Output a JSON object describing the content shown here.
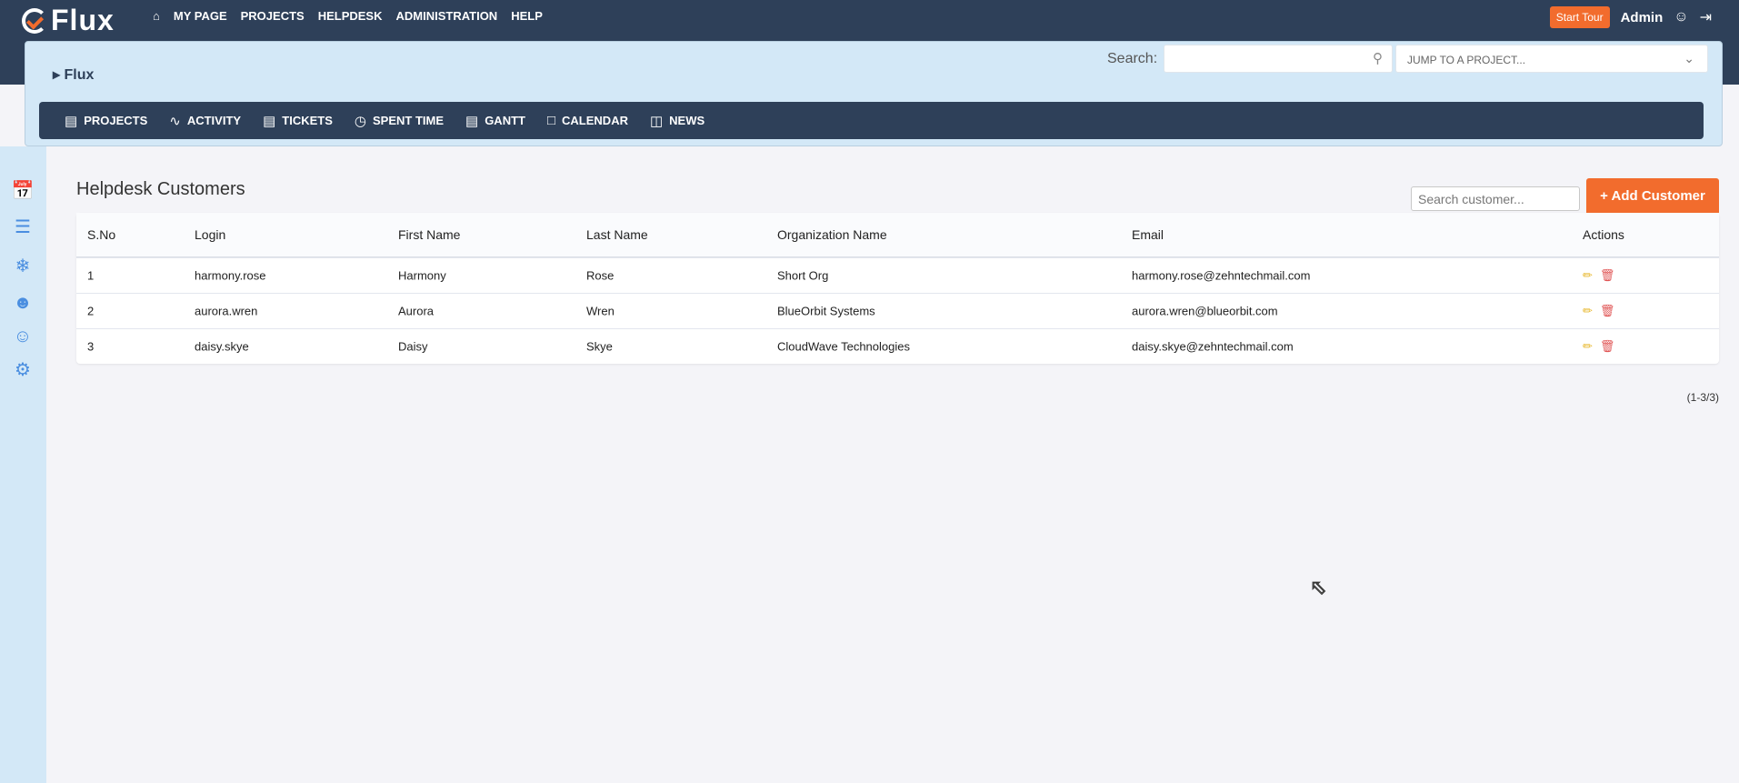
{
  "app": {
    "brand": "Flux"
  },
  "topnav": {
    "items": [
      "MY PAGE",
      "PROJECTS",
      "HELPDESK",
      "ADMINISTRATION",
      "HELP"
    ],
    "start_tour": "Start Tour",
    "user": "Admin"
  },
  "header": {
    "breadcrumb": "Flux",
    "search_label": "Search:",
    "search_value": "",
    "jump_placeholder": "JUMP TO A PROJECT..."
  },
  "project_menu": [
    "PROJECTS",
    "ACTIVITY",
    "TICKETS",
    "SPENT TIME",
    "GANTT",
    "CALENDAR",
    "NEWS"
  ],
  "page": {
    "title": "Helpdesk Customers",
    "search_placeholder": "Search customer...",
    "add_button": "+ Add Customer",
    "pagination": "(1-3/3)"
  },
  "table": {
    "columns": [
      "S.No",
      "Login",
      "First Name",
      "Last Name",
      "Organization Name",
      "Email",
      "Actions"
    ],
    "rows": [
      [
        "1",
        "harmony.rose",
        "Harmony",
        "Rose",
        "Short Org",
        "harmony.rose@zehntechmail.com"
      ],
      [
        "2",
        "aurora.wren",
        "Aurora",
        "Wren",
        "BlueOrbit Systems",
        "aurora.wren@blueorbit.com"
      ],
      [
        "3",
        "daisy.skye",
        "Daisy",
        "Skye",
        "CloudWave Technologies",
        "daisy.skye@zehntechmail.com"
      ]
    ]
  },
  "colors": {
    "navy": "#2e4059",
    "accent": "#f26c2d",
    "light_blue": "#d3e8f7"
  }
}
